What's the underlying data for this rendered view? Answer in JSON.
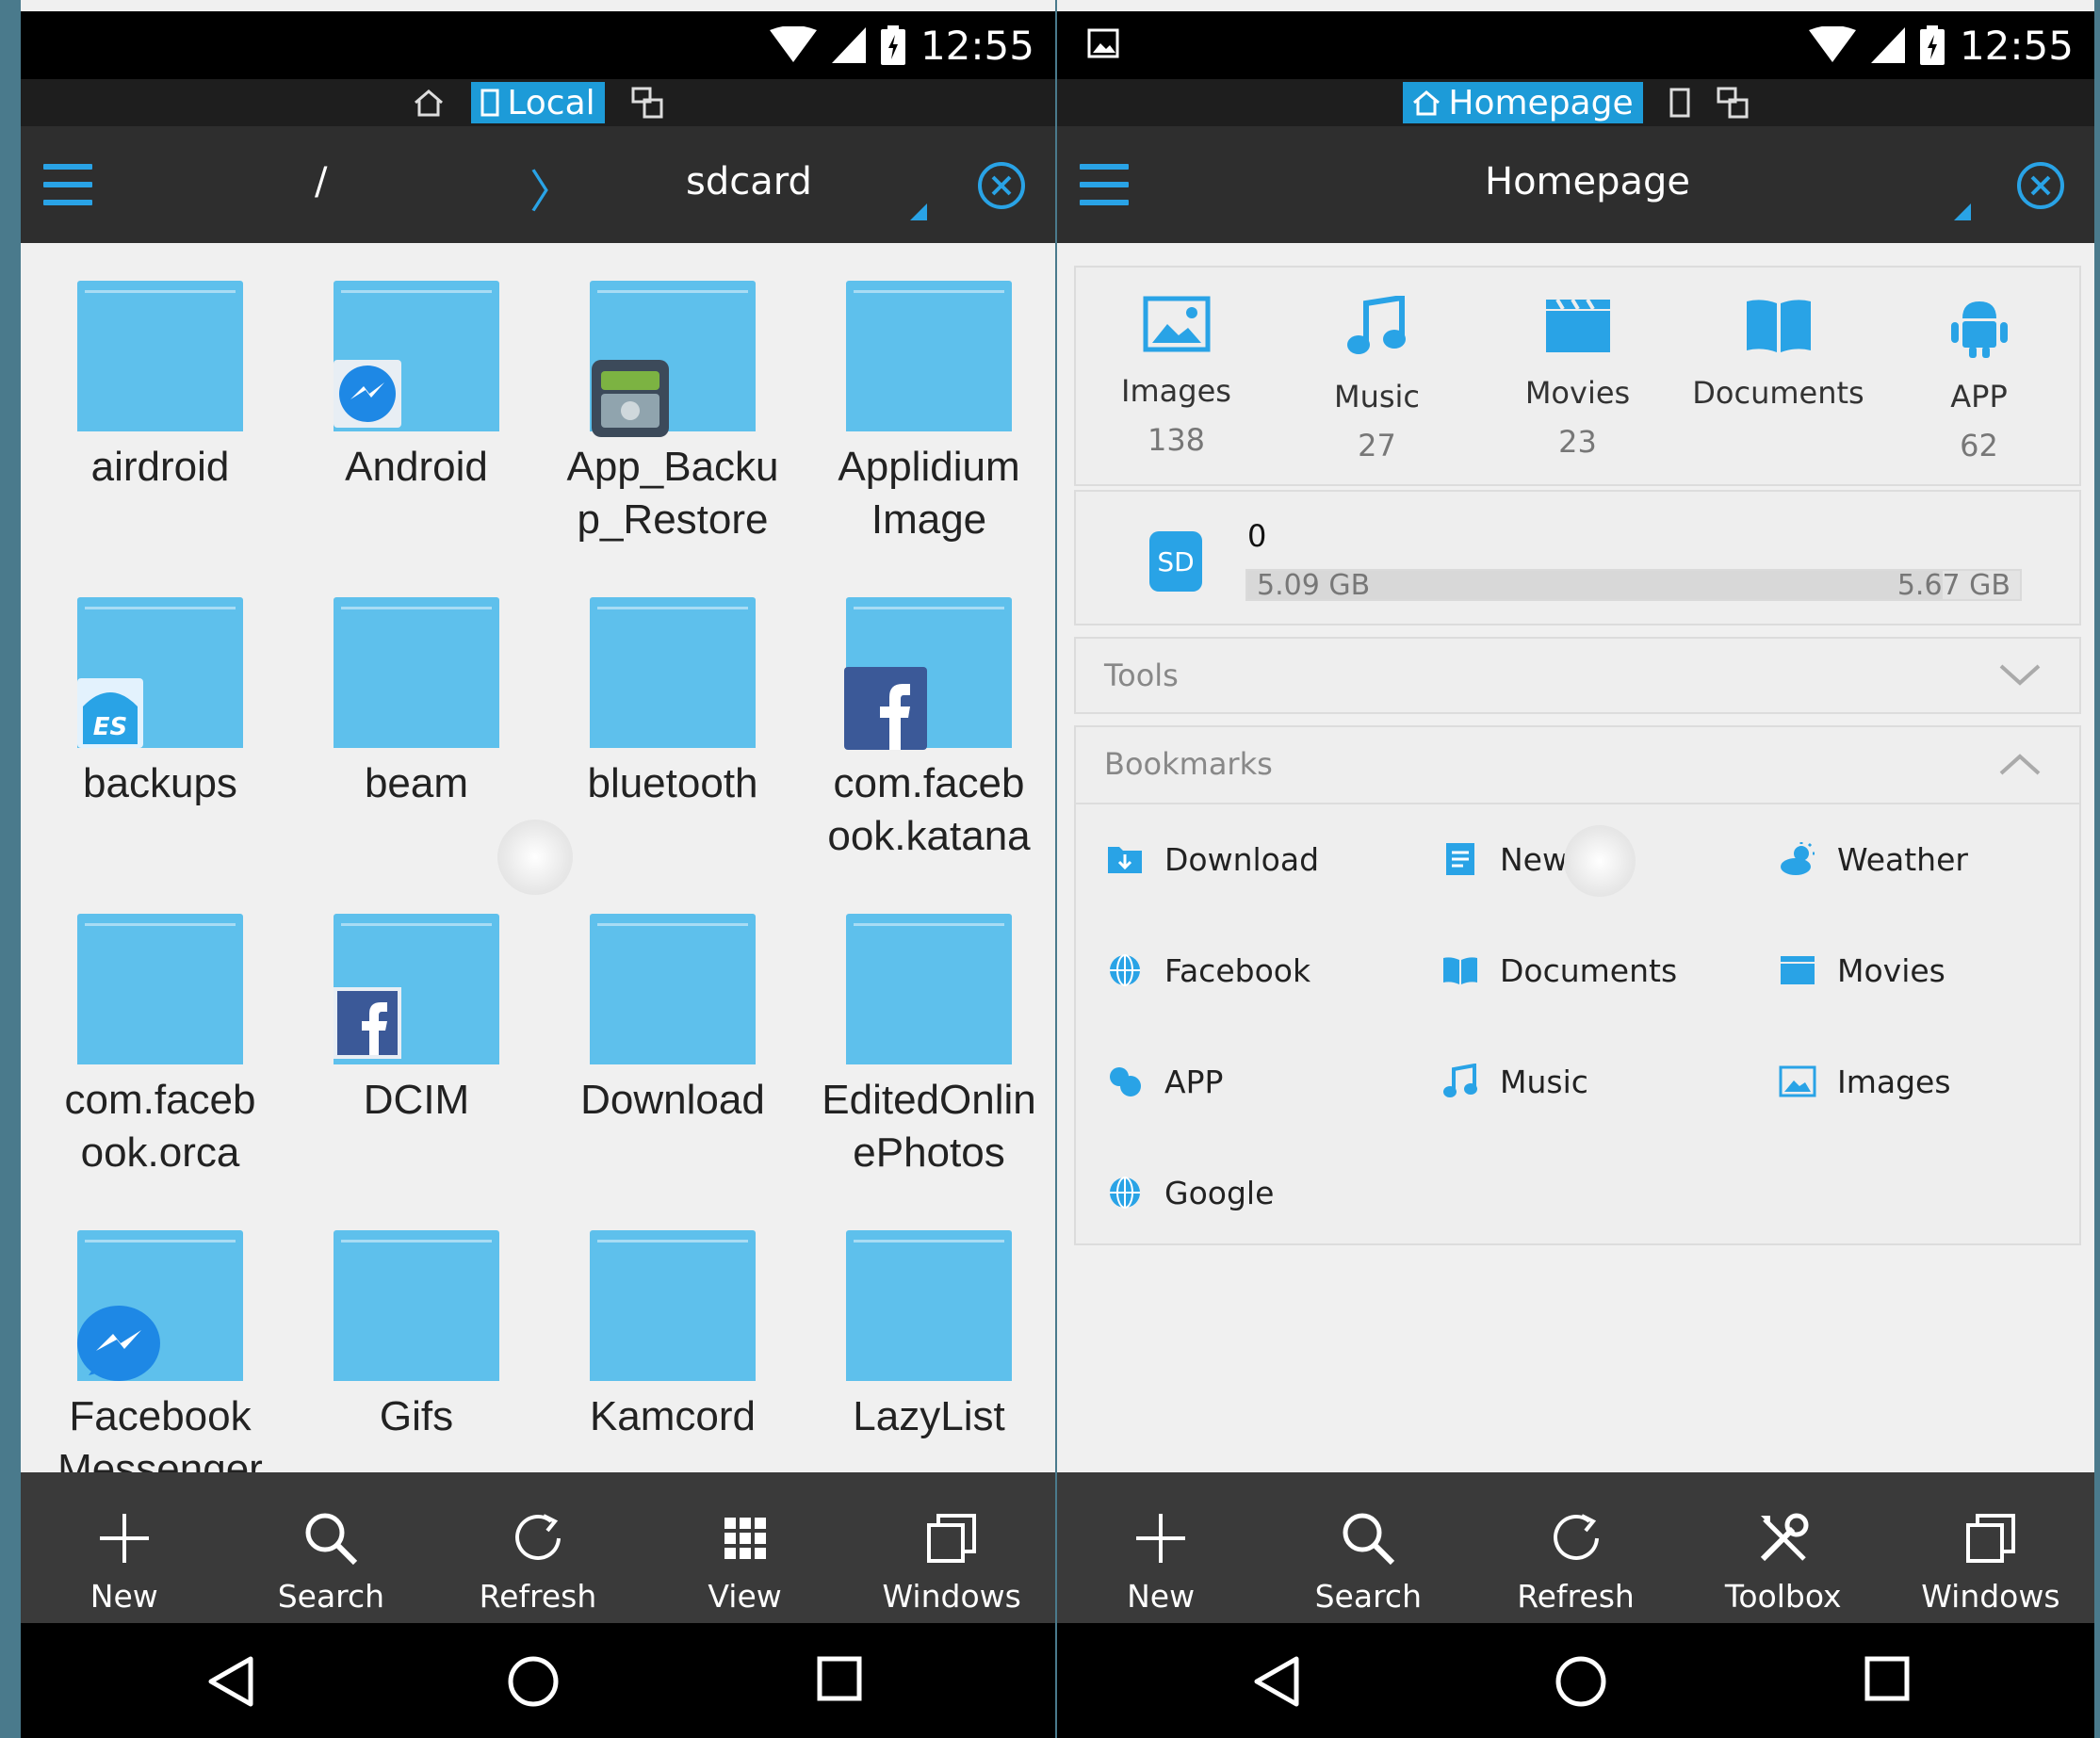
{
  "status": {
    "time": "12:55"
  },
  "left": {
    "location_tab": "Local",
    "path": {
      "root": "/",
      "current": "sdcard"
    },
    "files": [
      "airdroid",
      "Android",
      "App_Backup_Restore",
      "Applidium Image",
      "backups",
      "beam",
      "bluetooth",
      "com.facebook.katana",
      "com.facebook.orca",
      "DCIM",
      "Download",
      "EditedOnlinePhotos",
      "Facebook Messenger",
      "Gifs",
      "Kamcord",
      "LazyList"
    ],
    "file_labels": [
      [
        "airdroid"
      ],
      [
        "Android"
      ],
      [
        "App_Backu",
        "p_Restore"
      ],
      [
        "Applidium",
        "Image"
      ],
      [
        "backups"
      ],
      [
        "beam"
      ],
      [
        "bluetooth"
      ],
      [
        "com.faceb",
        "ook.katana"
      ],
      [
        "com.faceb",
        "ook.orca"
      ],
      [
        "DCIM"
      ],
      [
        "Download"
      ],
      [
        "EditedOnlin",
        "ePhotos"
      ],
      [
        "Facebook",
        "Messenger"
      ],
      [
        "Gifs"
      ],
      [
        "Kamcord"
      ],
      [
        "LazyList"
      ]
    ],
    "actions": [
      "New",
      "Search",
      "Refresh",
      "View",
      "Windows"
    ]
  },
  "right": {
    "location_tab": "Homepage",
    "title": "Homepage",
    "categories": [
      {
        "label": "Images",
        "count": "138"
      },
      {
        "label": "Music",
        "count": "27"
      },
      {
        "label": "Movies",
        "count": "23"
      },
      {
        "label": "Documents",
        "count": ""
      },
      {
        "label": "APP",
        "count": "62"
      }
    ],
    "storage": {
      "badge": "SD",
      "name": "0",
      "used": "5.09 GB",
      "total": "5.67 GB",
      "fraction": 0.9
    },
    "tools_title": "Tools",
    "bookmarks_title": "Bookmarks",
    "bookmarks": [
      "Download",
      "News",
      "Weather",
      "Facebook",
      "Documents",
      "Movies",
      "APP",
      "Music",
      "Images",
      "Google"
    ],
    "actions": [
      "New",
      "Search",
      "Refresh",
      "Toolbox",
      "Windows"
    ]
  },
  "colors": {
    "accent": "#29a3e6",
    "folder": "#5ec0ec"
  }
}
